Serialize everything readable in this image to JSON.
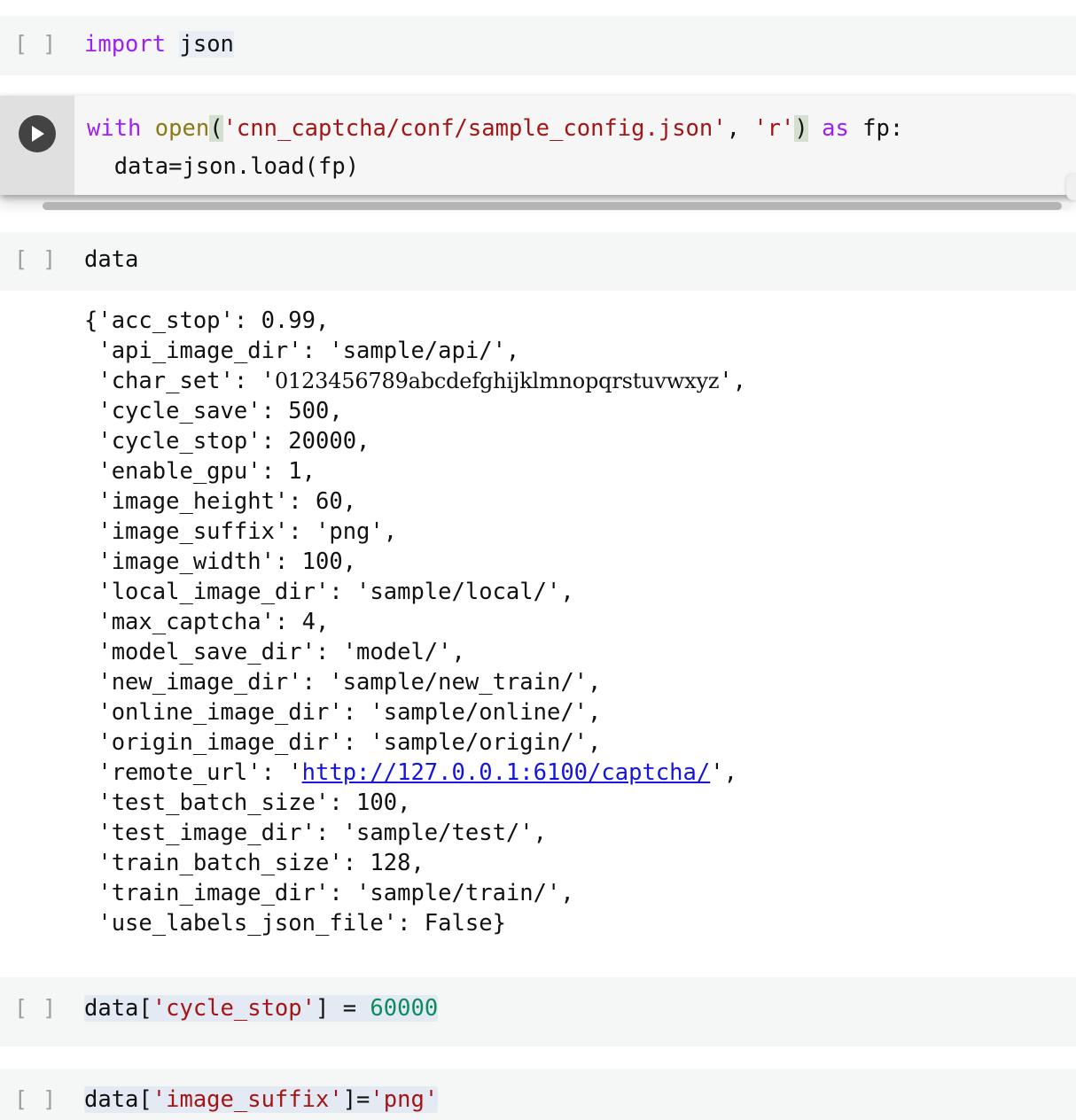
{
  "theme": {
    "page_bg": "#ffffff",
    "cell_bg": "#f5f6f6",
    "gutter_bg": "#e0e0e0",
    "run_button_bg": "#434343",
    "prompt_color": "#9e9e9e",
    "keyword_color": "#a020f0",
    "builtin_color": "#8a7a13",
    "string_color": "#a41515",
    "number_color": "#0e8a5f",
    "selection_bg": "#e4eaf3",
    "paren_match_bg": "#d5dfcf",
    "link_color": "#1414dd",
    "scrollbar_thumb": "#b5b5b5"
  },
  "cells": [
    {
      "id": "cell-import",
      "prompt": "[ ]",
      "tokens": [
        {
          "text": "import",
          "type": "keyword"
        },
        {
          "text": " ",
          "type": "plain"
        },
        {
          "text": "json",
          "type": "selected"
        }
      ]
    },
    {
      "id": "cell-active",
      "prompt": "",
      "run_icon": "play-icon",
      "line1_tokens": [
        {
          "text": "with",
          "type": "keyword"
        },
        {
          "text": " ",
          "type": "plain"
        },
        {
          "text": "open",
          "type": "builtin"
        },
        {
          "text": "(",
          "type": "paren-match"
        },
        {
          "text": "'cnn_captcha/conf/sample_config.json'",
          "type": "string"
        },
        {
          "text": ", ",
          "type": "plain"
        },
        {
          "text": "'r'",
          "type": "string"
        },
        {
          "text": ")",
          "type": "paren-match"
        },
        {
          "text": " ",
          "type": "plain"
        },
        {
          "text": "as",
          "type": "keyword"
        },
        {
          "text": " fp:",
          "type": "plain"
        }
      ],
      "line2": "  data=json.load(fp)"
    },
    {
      "id": "cell-data",
      "prompt": "[ ]",
      "tokens": [
        {
          "text": "data",
          "type": "plain"
        }
      ]
    },
    {
      "id": "cell-set-cycle",
      "prompt": "[ ]",
      "tokens": [
        {
          "text": "data[",
          "type": "plain"
        },
        {
          "text": "'cycle_stop'",
          "type": "string"
        },
        {
          "text": "] = ",
          "type": "plain"
        },
        {
          "text": "60000",
          "type": "number"
        }
      ]
    },
    {
      "id": "cell-set-suffix",
      "prompt": "[ ]",
      "tokens": [
        {
          "text": "data[",
          "type": "plain"
        },
        {
          "text": "'image_suffix'",
          "type": "string"
        },
        {
          "text": "]=",
          "type": "plain"
        },
        {
          "text": "'png'",
          "type": "string"
        }
      ]
    }
  ],
  "output": {
    "lines": [
      "{'acc_stop': 0.99,",
      " 'api_image_dir': 'sample/api/',",
      " 'char_set': '0123456789abcdefghijklmnopqrstuvwxyz',",
      " 'cycle_save': 500,",
      " 'cycle_stop': 20000,",
      " 'enable_gpu': 1,",
      " 'image_height': 60,",
      " 'image_suffix': 'png',",
      " 'image_width': 100,",
      " 'local_image_dir': 'sample/local/',",
      " 'max_captcha': 4,",
      " 'model_save_dir': 'model/',",
      " 'new_image_dir': 'sample/new_train/',",
      " 'online_image_dir': 'sample/online/',",
      " 'origin_image_dir': 'sample/origin/',",
      " 'remote_url': 'http://127.0.0.1:6100/captcha/',",
      " 'test_batch_size': 100,",
      " 'test_image_dir': 'sample/test/',",
      " 'train_batch_size': 128,",
      " 'train_image_dir': 'sample/train/',",
      " 'use_labels_json_file': False}"
    ],
    "dict_values": {
      "acc_stop": "0.99",
      "api_image_dir": "sample/api/",
      "char_set": "0123456789abcdefghijklmnopqrstuvwxyz",
      "cycle_save": "500",
      "cycle_stop": "20000",
      "enable_gpu": "1",
      "image_height": "60",
      "image_suffix": "png",
      "image_width": "100",
      "local_image_dir": "sample/local/",
      "max_captcha": "4",
      "model_save_dir": "model/",
      "new_image_dir": "sample/new_train/",
      "online_image_dir": "sample/online/",
      "origin_image_dir": "sample/origin/",
      "remote_url": "http://127.0.0.1:6100/captcha/",
      "test_batch_size": "100",
      "test_image_dir": "sample/test/",
      "train_batch_size": "128",
      "train_image_dir": "sample/train/",
      "use_labels_json_file": "False"
    },
    "link_text": "http://127.0.0.1:6100/captcha/"
  },
  "scrollbar": {
    "orientation": "horizontal",
    "position": "left"
  }
}
